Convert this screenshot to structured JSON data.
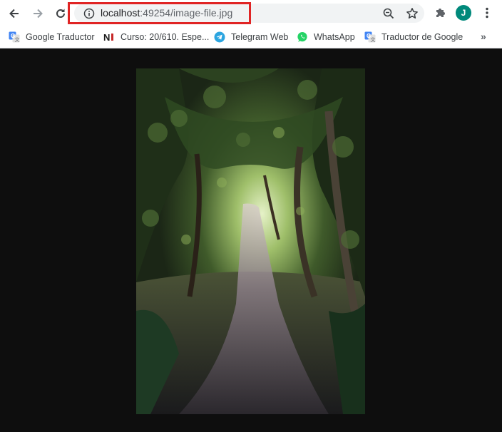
{
  "window": {
    "title": "image-file.jpg"
  },
  "toolbar": {
    "back": "back-arrow-icon",
    "forward": "forward-arrow-icon",
    "reload": "reload-icon",
    "url_host": "localhost",
    "url_path": ":49254/image-file.jpg",
    "zoom": "zoom-icon",
    "star": "bookmark-star-icon",
    "extensions": "puzzle-icon",
    "profile_initial": "J",
    "menu": "kebab-menu-icon"
  },
  "colors": {
    "highlight": "#e02424",
    "avatar": "#00897b",
    "viewer_background": "#0e0e0e"
  },
  "bookmarks": [
    {
      "label": "Google Traductor",
      "icon": "google-translate-icon"
    },
    {
      "label": "Curso: 20/610. Espe...",
      "icon": "ni-logo-icon"
    },
    {
      "label": "Telegram Web",
      "icon": "telegram-icon"
    },
    {
      "label": "WhatsApp",
      "icon": "whatsapp-icon"
    },
    {
      "label": "Traductor de Google",
      "icon": "google-translate-icon"
    }
  ],
  "bookmarks_overflow": "»"
}
